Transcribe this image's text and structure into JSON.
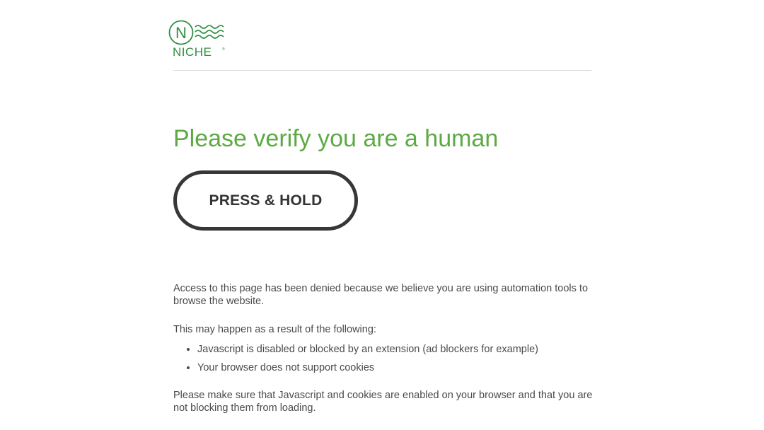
{
  "brand": {
    "logo_text": "NICHE",
    "logo_letter": "N",
    "color": "#2f8f3f"
  },
  "title": "Please verify you are a human",
  "title_color": "#5da944",
  "hold_button": {
    "label": "PRESS & HOLD"
  },
  "messages": {
    "denied": "Access to this page has been denied because we believe you are using automation tools to browse the website.",
    "reasons_intro": "This may happen as a result of the following:",
    "reasons": [
      "Javascript is disabled or blocked by an extension (ad blockers for example)",
      "Your browser does not support cookies"
    ],
    "advice": "Please make sure that Javascript and cookies are enabled on your browser and that you are not blocking them from loading."
  }
}
